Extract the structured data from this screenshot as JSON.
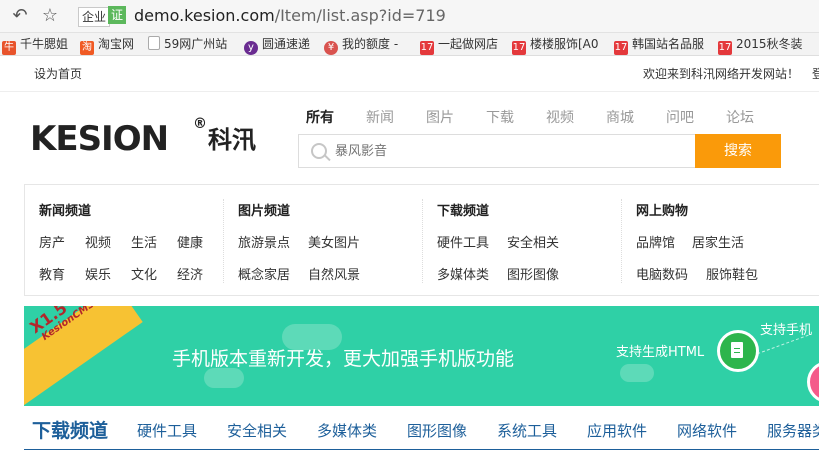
{
  "browser": {
    "back_icon": "back-arrow-icon",
    "bookmark_star_icon": "star-icon",
    "enterprise_badge": "企业",
    "cert_badge": "证",
    "url_host": "demo.kesion.com",
    "url_path": "/Item/list.asp?id=719"
  },
  "bookmarks": [
    {
      "label": "千牛腮姐",
      "icon": "qianniu-icon",
      "color": "#e8542c"
    },
    {
      "label": "淘宝网",
      "icon": "taobao-icon",
      "color": "#f05a24"
    },
    {
      "label": "59网广州站",
      "icon": "page-icon",
      "color": "#9a9a9a"
    },
    {
      "label": "圆通速递",
      "icon": "yto-icon",
      "color": "#6a2c91"
    },
    {
      "label": "我的额度 -",
      "icon": "credit-icon",
      "color": "#d9534f"
    },
    {
      "label": "一起做网店",
      "icon": "17zwd-icon",
      "color": "#e4393c"
    },
    {
      "label": "楼楼服饰[A0",
      "icon": "17zwd-icon",
      "color": "#e4393c"
    },
    {
      "label": "韩国站名品服",
      "icon": "17zwd-icon",
      "color": "#e4393c"
    },
    {
      "label": "2015秋冬装",
      "icon": "17zwd-icon",
      "color": "#e4393c"
    }
  ],
  "topbar": {
    "set_home": "设为首页",
    "welcome": "欢迎来到科汛网络开发网站！",
    "login_fragment": "登"
  },
  "logo": {
    "en": "KESION",
    "reg": "®",
    "cn": "科汛"
  },
  "search": {
    "tabs": [
      "所有",
      "新闻",
      "图片",
      "下载",
      "视频",
      "商城",
      "问吧",
      "论坛"
    ],
    "active_tab": "所有",
    "placeholder": "暴风影音",
    "button": "搜索"
  },
  "channels": [
    {
      "title": "新闻频道",
      "links": [
        "房产",
        "视频",
        "生活",
        "健康",
        "教育",
        "娱乐",
        "文化",
        "经济"
      ]
    },
    {
      "title": "图片频道",
      "links": [
        "旅游景点",
        "美女图片",
        "概念家居",
        "自然风景"
      ]
    },
    {
      "title": "下载频道",
      "links": [
        "硬件工具",
        "安全相关",
        "多媒体类",
        "图形图像"
      ]
    },
    {
      "title": "网上购物",
      "links": [
        "品牌馆",
        "居家生活",
        "电脑数码",
        "服饰鞋包"
      ]
    }
  ],
  "banner": {
    "ribbon_version": "X1.5",
    "ribbon_product": "KesionCMS",
    "title": "手机版本重新开发，更大加强手机版功能",
    "feature_html": "支持生成HTML",
    "feature_mobile": "支持手机",
    "accent": "#2fd0a6"
  },
  "subnav": {
    "title": "下载频道",
    "links": [
      "硬件工具",
      "安全相关",
      "多媒体类",
      "图形图像",
      "系统工具",
      "应用软件",
      "网络软件",
      "服务器类"
    ]
  }
}
